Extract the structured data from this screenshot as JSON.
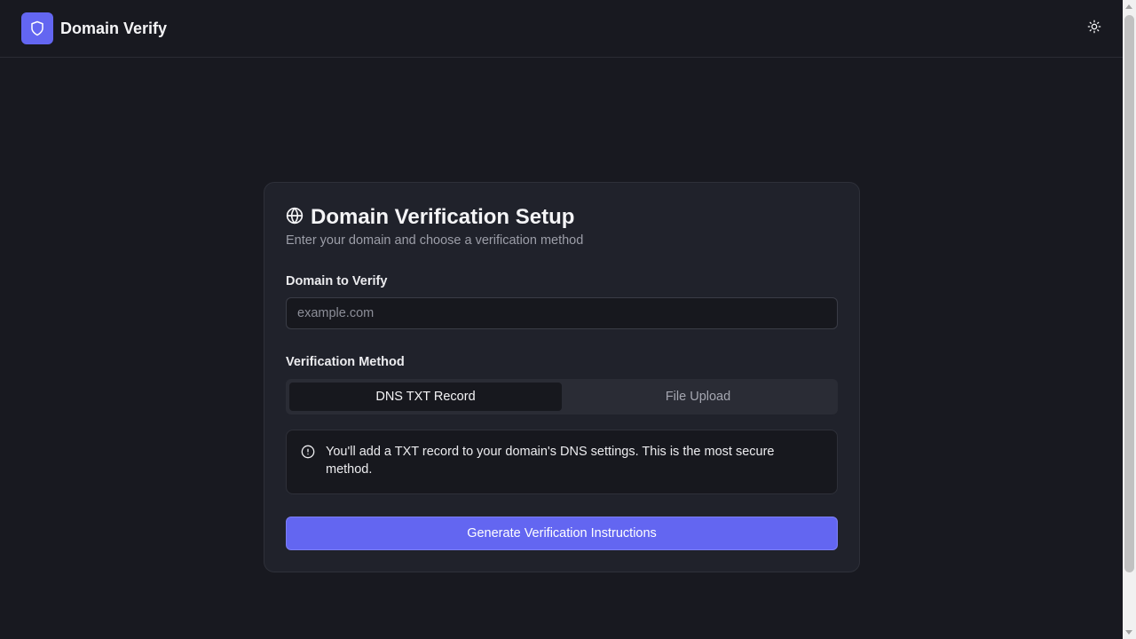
{
  "app": {
    "brand_name": "Domain Verify",
    "brand_icon": "shield-icon",
    "theme_toggle_icon": "sun-icon"
  },
  "card": {
    "title_icon": "globe-icon",
    "title": "Domain Verification Setup",
    "subtitle": "Enter your domain and choose a verification method",
    "domain_label": "Domain to Verify",
    "domain_placeholder": "example.com",
    "domain_value": "",
    "method_label": "Verification Method",
    "tabs": [
      {
        "label": "DNS TXT Record",
        "active": true
      },
      {
        "label": "File Upload",
        "active": false
      }
    ],
    "alert_icon": "info-circle-icon",
    "alert_text": "You'll add a TXT record to your domain's DNS settings. This is the most secure method.",
    "submit_label": "Generate Verification Instructions"
  },
  "colors": {
    "background": "#181920",
    "card": "#20222b",
    "accent": "#6366f1"
  }
}
